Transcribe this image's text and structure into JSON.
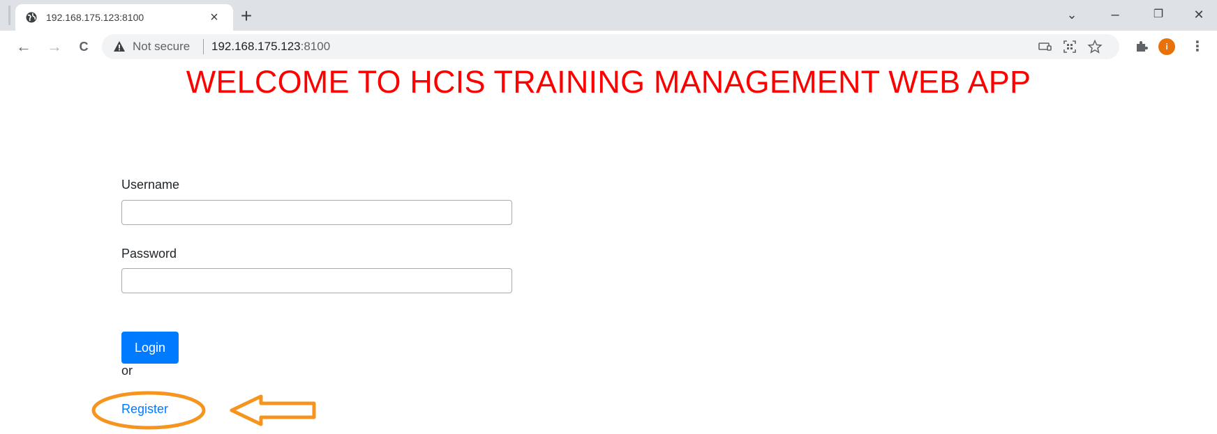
{
  "browser": {
    "tab_title": "192.168.175.123:8100",
    "tab_close": "×",
    "new_tab": "+",
    "window_controls": {
      "tab_search": "⌄",
      "minimize": "–",
      "restore": "❐",
      "close": "✕"
    },
    "nav": {
      "back": "←",
      "forward": "→",
      "reload": "C"
    },
    "security_label": "Not secure",
    "url_host": "192.168.175.123",
    "url_port": ":8100",
    "profile_initial": "i",
    "icons": {
      "favicon": "globe-icon",
      "warning": "warning-icon",
      "cast": "cast-icon",
      "qr": "qr-code-icon",
      "bookmark": "star-icon",
      "extensions": "puzzle-icon",
      "menu": "kebab-menu-icon"
    }
  },
  "page": {
    "heading": "WELCOME TO HCIS TRAINING MANAGEMENT WEB APP",
    "heading_color": "#ff0000",
    "form": {
      "username_label": "Username",
      "username_value": "",
      "password_label": "Password",
      "password_value": "",
      "login_label": "Login",
      "or_text": "or",
      "register_label": "Register"
    },
    "accent_color": "#007bff",
    "annotation_color": "#f7941d"
  }
}
